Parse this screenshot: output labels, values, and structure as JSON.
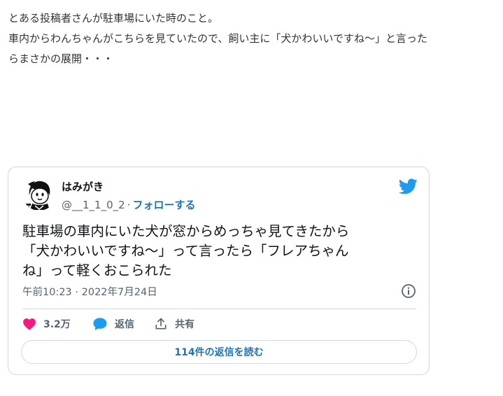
{
  "article": {
    "line1": "とある投稿者さんが駐車場にいた時のこと。",
    "line2": "車内からわんちゃんがこちらを見ていたので、飼い主に「犬かわいいですね〜」と言った",
    "line3": "らまさかの展開・・・"
  },
  "tweet": {
    "author_name": "はみがき",
    "author_handle": "@__1_1_0_2",
    "separator": "·",
    "follow_label": "フォローする",
    "text_line1": "駐車場の車内にいた犬が窓からめっちゃ見てきたから",
    "text_line2": "「犬かわいいですね〜」って言ったら「フレアちゃん",
    "text_line3": "ね」って軽くおこられた",
    "timestamp": "午前10:23 · 2022年7月24日",
    "likes_count": "3.2万",
    "reply_label": "返信",
    "share_label": "共有",
    "read_replies_label": "114件の返信を読む"
  },
  "icons": {
    "bird": "twitter-bird-icon",
    "info": "info-icon",
    "like": "heart-icon",
    "reply": "speech-bubble-icon",
    "share": "share-upload-icon"
  },
  "colors": {
    "twitter_blue": "#1d9bf0",
    "link_blue": "#1d73b8",
    "heart_pink": "#f91880",
    "muted_text": "#536471",
    "border": "#cfd9de"
  }
}
